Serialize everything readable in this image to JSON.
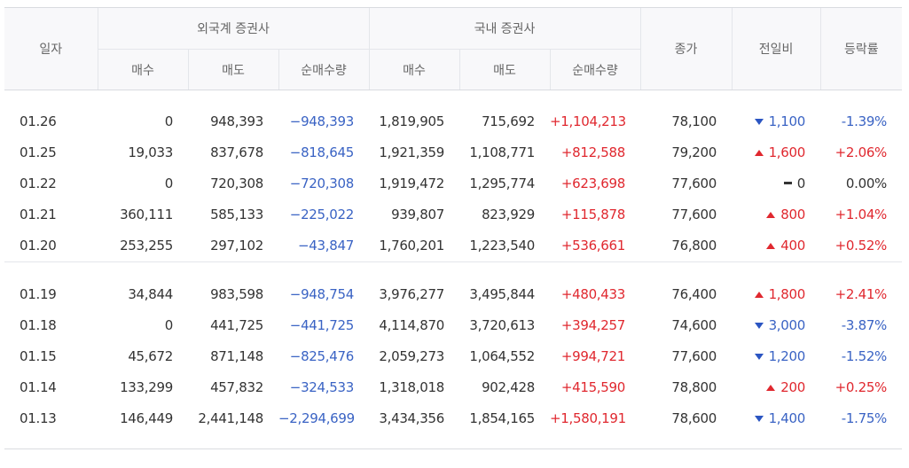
{
  "header": {
    "date": "일자",
    "foreign": "외국계 증권사",
    "domestic": "국내 증권사",
    "buy": "매수",
    "sell": "매도",
    "net": "순매수량",
    "close": "종가",
    "change": "전일비",
    "rate": "등락률"
  },
  "colors": {
    "negative": "#3a63c4",
    "positive": "#e0282f",
    "up_arrow": "#e0282f",
    "down_arrow": "#2b55c2"
  },
  "groups": [
    [
      {
        "date": "01.26",
        "f_buy": "0",
        "f_sell": "948,393",
        "f_net": "−948,393",
        "d_buy": "1,819,905",
        "d_sell": "715,692",
        "d_net": "+1,104,213",
        "close": "78,100",
        "dir": "down",
        "change": "1,100",
        "rate": "-1.39%"
      },
      {
        "date": "01.25",
        "f_buy": "19,033",
        "f_sell": "837,678",
        "f_net": "−818,645",
        "d_buy": "1,921,359",
        "d_sell": "1,108,771",
        "d_net": "+812,588",
        "close": "79,200",
        "dir": "up",
        "change": "1,600",
        "rate": "+2.06%"
      },
      {
        "date": "01.22",
        "f_buy": "0",
        "f_sell": "720,308",
        "f_net": "−720,308",
        "d_buy": "1,919,472",
        "d_sell": "1,295,774",
        "d_net": "+623,698",
        "close": "77,600",
        "dir": "flat",
        "change": "0",
        "rate": "0.00%"
      },
      {
        "date": "01.21",
        "f_buy": "360,111",
        "f_sell": "585,133",
        "f_net": "−225,022",
        "d_buy": "939,807",
        "d_sell": "823,929",
        "d_net": "+115,878",
        "close": "77,600",
        "dir": "up",
        "change": "800",
        "rate": "+1.04%"
      },
      {
        "date": "01.20",
        "f_buy": "253,255",
        "f_sell": "297,102",
        "f_net": "−43,847",
        "d_buy": "1,760,201",
        "d_sell": "1,223,540",
        "d_net": "+536,661",
        "close": "76,800",
        "dir": "up",
        "change": "400",
        "rate": "+0.52%"
      }
    ],
    [
      {
        "date": "01.19",
        "f_buy": "34,844",
        "f_sell": "983,598",
        "f_net": "−948,754",
        "d_buy": "3,976,277",
        "d_sell": "3,495,844",
        "d_net": "+480,433",
        "close": "76,400",
        "dir": "up",
        "change": "1,800",
        "rate": "+2.41%"
      },
      {
        "date": "01.18",
        "f_buy": "0",
        "f_sell": "441,725",
        "f_net": "−441,725",
        "d_buy": "4,114,870",
        "d_sell": "3,720,613",
        "d_net": "+394,257",
        "close": "74,600",
        "dir": "down",
        "change": "3,000",
        "rate": "-3.87%"
      },
      {
        "date": "01.15",
        "f_buy": "45,672",
        "f_sell": "871,148",
        "f_net": "−825,476",
        "d_buy": "2,059,273",
        "d_sell": "1,064,552",
        "d_net": "+994,721",
        "close": "77,600",
        "dir": "down",
        "change": "1,200",
        "rate": "-1.52%"
      },
      {
        "date": "01.14",
        "f_buy": "133,299",
        "f_sell": "457,832",
        "f_net": "−324,533",
        "d_buy": "1,318,018",
        "d_sell": "902,428",
        "d_net": "+415,590",
        "close": "78,800",
        "dir": "up",
        "change": "200",
        "rate": "+0.25%"
      },
      {
        "date": "01.13",
        "f_buy": "146,449",
        "f_sell": "2,441,148",
        "f_net": "−2,294,699",
        "d_buy": "3,434,356",
        "d_sell": "1,854,165",
        "d_net": "+1,580,191",
        "close": "78,600",
        "dir": "down",
        "change": "1,400",
        "rate": "-1.75%"
      }
    ]
  ]
}
